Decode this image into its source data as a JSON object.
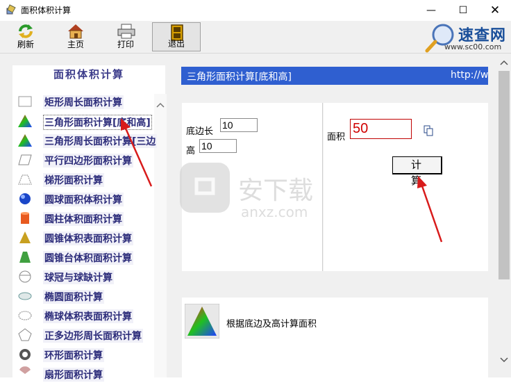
{
  "window": {
    "title": "面积体积计算"
  },
  "toolbar": {
    "refresh": "刷新",
    "home": "主页",
    "print": "打印",
    "exit": "退出"
  },
  "logo": {
    "brand": "速查网",
    "url": "www.sc00.com"
  },
  "sidebar": {
    "title": "面积体积计算",
    "items": [
      {
        "label": "矩形周长面积计算",
        "icon": "rectangle-icon"
      },
      {
        "label": "三角形面积计算[底和高]",
        "icon": "triangle-color-icon"
      },
      {
        "label": "三角形周长面积计算[三边",
        "icon": "triangle-color-icon"
      },
      {
        "label": "平行四边形面积计算",
        "icon": "parallelogram-icon"
      },
      {
        "label": "梯形面积计算",
        "icon": "trapezoid-icon"
      },
      {
        "label": "圆球面积体积计算",
        "icon": "sphere-icon"
      },
      {
        "label": "圆柱体积面积计算",
        "icon": "cylinder-icon"
      },
      {
        "label": "圆锥体积表面积计算",
        "icon": "cone-icon"
      },
      {
        "label": "圆锥台体积面积计算",
        "icon": "frustum-icon"
      },
      {
        "label": "球冠与球缺计算",
        "icon": "spherical-cap-icon"
      },
      {
        "label": "椭圆面积计算",
        "icon": "ellipse-icon"
      },
      {
        "label": "椭球体积表面积计算",
        "icon": "ellipsoid-icon"
      },
      {
        "label": "正多边形周长面积计算",
        "icon": "polygon-icon"
      },
      {
        "label": "环形面积计算",
        "icon": "ring-icon"
      },
      {
        "label": "扇形面积计算",
        "icon": "sector-icon"
      }
    ]
  },
  "content": {
    "header_title": "三角形面积计算[底和高]",
    "header_url": "http://w",
    "base_label": "底边长",
    "base_value": "10",
    "height_label": "高",
    "height_value": "10",
    "area_label": "面积",
    "area_value": "50",
    "calc_button": "计 算",
    "description": "根据底边及高计算面积"
  },
  "colors": {
    "header": "#2f5fd0",
    "accent_red": "#d81b1b",
    "sidebar_text": "#2c2c7a"
  }
}
